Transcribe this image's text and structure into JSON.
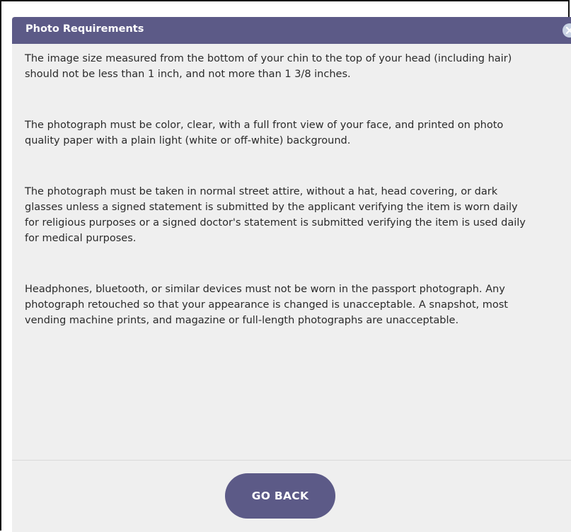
{
  "dialog": {
    "title": "Photo Requirements",
    "close_icon": "close-icon",
    "paragraphs": [
      "The image size measured from the bottom of your chin to the top of your head (including hair) should not be less than 1 inch, and not more than 1 3/8 inches.",
      "The photograph must be color, clear, with a full front view of your face, and printed on photo quality paper with a plain light (white or off-white) background.",
      "The photograph must be taken in normal street attire, without a hat, head covering, or dark glasses unless a signed statement is submitted by the applicant verifying the item is worn daily for religious purposes or a signed doctor's statement is submitted verifying the item is used daily for medical purposes.",
      "Headphones, bluetooth, or similar devices must not be worn in the passport photograph. Any photograph retouched so that your appearance is changed is unacceptable. A snapshot, most vending machine prints, and magazine or full-length photographs are unacceptable."
    ],
    "back_label": "GO BACK"
  },
  "colors": {
    "header_bg": "#5c5a87",
    "body_bg": "#efefef",
    "button_bg": "#5c5a87",
    "close_bg": "#c9d3e4"
  }
}
